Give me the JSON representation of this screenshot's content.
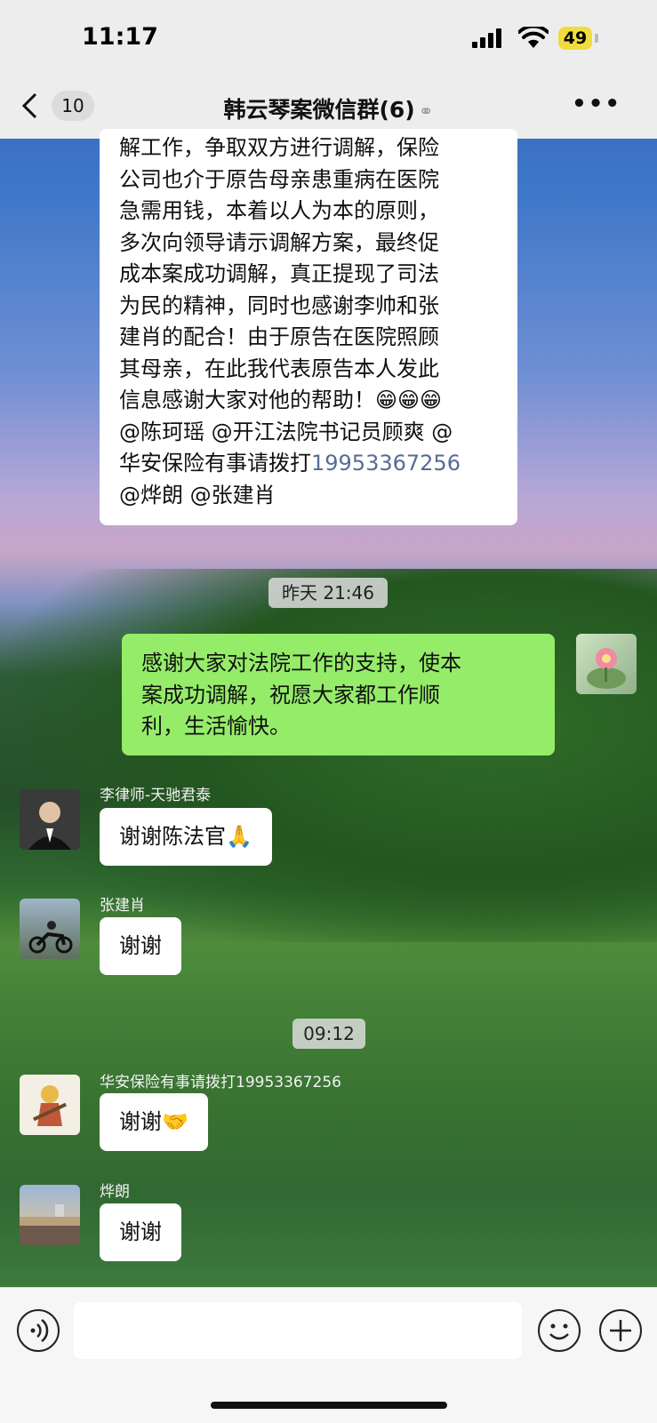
{
  "status": {
    "time": "11:17",
    "battery": "49"
  },
  "nav": {
    "back_count": "10",
    "title": "韩云琴案微信群(6)"
  },
  "msg1": {
    "lines": [
      "解工作，争取双方进行调解，保险",
      "公司也介于原告母亲患重病在医院",
      "急需用钱，本着以人为本的原则，",
      "多次向领导请示调解方案，最终促",
      "成本案成功调解，真正提现了司法",
      "为民的精神，同时也感谢李帅和张",
      "建肖的配合！由于原告在医院照顾",
      "其母亲，在此我代表原告本人发此",
      "信息感谢大家对他的帮助！😁😁😁",
      "@陈珂瑶 @开江法院书记员顾爽 @"
    ],
    "line_prefix": "华安保险有事请拨打",
    "phone": "19953367256",
    "last_line": "@烨朗 @张建肖"
  },
  "timestamp1": "昨天 21:46",
  "msg2": {
    "lines": [
      "感谢大家对法院工作的支持，使本",
      "案成功调解，祝愿大家都工作顺",
      "利，生活愉快。"
    ]
  },
  "msg3": {
    "sender": "李律师-天驰君泰",
    "text": "谢谢陈法官🙏"
  },
  "msg4": {
    "sender": "张建肖",
    "text": "谢谢"
  },
  "timestamp2": "09:12",
  "msg5": {
    "sender": "华安保险有事请拨打19953367256",
    "text": "谢谢🤝"
  },
  "msg6": {
    "sender": "烨朗",
    "text": "谢谢"
  },
  "colors": {
    "green_bubble": "#95ec69",
    "link": "#576b95",
    "bar": "#ededed"
  }
}
